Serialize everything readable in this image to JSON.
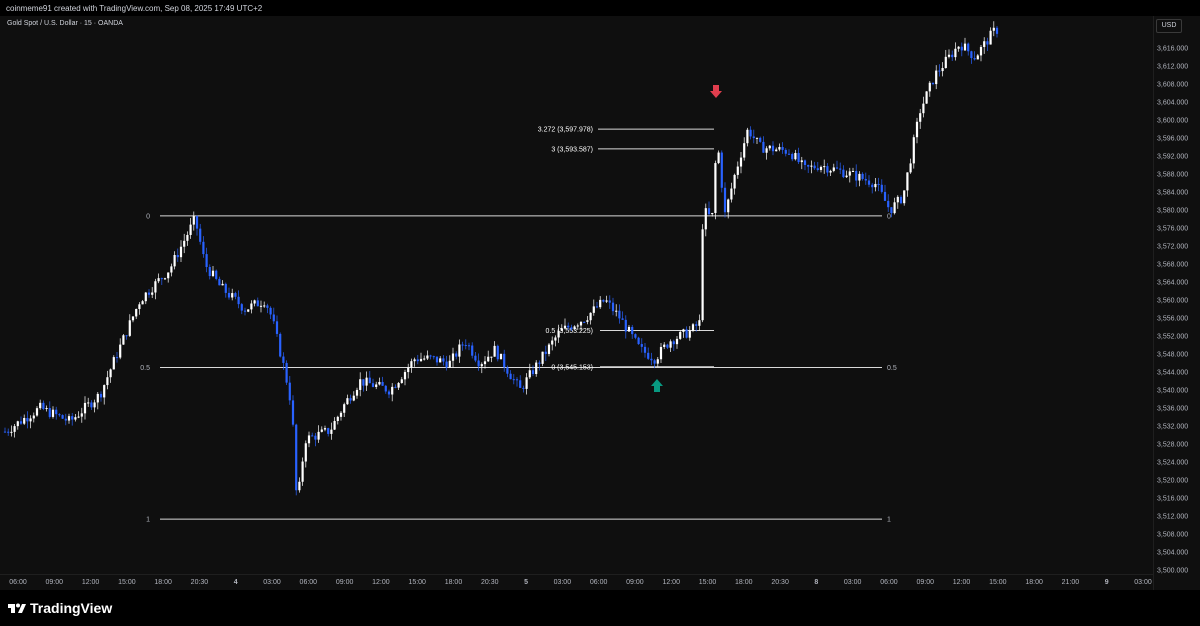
{
  "header": {
    "attribution": "coinmeme91 created with TradingView.com, Sep 08, 2025 17:49 UTC+2"
  },
  "chart": {
    "symbol_label": "Gold Spot / U.S. Dollar · 15 · OANDA",
    "currency": "USD",
    "colors": {
      "up": "#ffffff",
      "down": "#2962ff",
      "line": "#d9d9d9",
      "red_arrow": "#e03e4e",
      "green_arrow": "#089981"
    }
  },
  "chart_data": {
    "type": "candlestick",
    "ylim": [
      3500,
      3620
    ],
    "price_ticks": [
      "3,616.000",
      "3,612.000",
      "3,608.000",
      "3,604.000",
      "3,600.000",
      "3,596.000",
      "3,592.000",
      "3,588.000",
      "3,584.000",
      "3,580.000",
      "3,576.000",
      "3,572.000",
      "3,568.000",
      "3,564.000",
      "3,560.000",
      "3,556.000",
      "3,552.000",
      "3,548.000",
      "3,544.000",
      "3,540.000",
      "3,536.000",
      "3,532.000",
      "3,528.000",
      "3,524.000",
      "3,520.000",
      "3,516.000",
      "3,512.000",
      "3,508.000",
      "3,504.000",
      "3,500.000"
    ],
    "time_ticks": [
      "06:00",
      "09:00",
      "12:00",
      "15:00",
      "18:00",
      "20:30",
      "4",
      "03:00",
      "06:00",
      "09:00",
      "12:00",
      "15:00",
      "18:00",
      "20:30",
      "5",
      "03:00",
      "06:00",
      "09:00",
      "12:00",
      "15:00",
      "18:00",
      "20:30",
      "8",
      "03:00",
      "06:00",
      "09:00",
      "12:00",
      "15:00",
      "18:00",
      "21:00",
      "9",
      "03:00"
    ],
    "fib_main": [
      {
        "level": "0",
        "price": 3578.7
      },
      {
        "level": "0.5",
        "price": 3545.0
      },
      {
        "level": "1",
        "price": 3511.3
      }
    ],
    "fib_small": [
      {
        "label": "3.272 (3,597.978)",
        "price": 3597.978
      },
      {
        "label": "3 (3,593.587)",
        "price": 3593.587
      },
      {
        "label": "0.5 (3,553.225)",
        "price": 3553.225
      },
      {
        "label": "0 (3,545.153)",
        "price": 3545.153
      }
    ],
    "path": [
      [
        0,
        3530
      ],
      [
        40,
        3536
      ],
      [
        70,
        3533
      ],
      [
        100,
        3539
      ],
      [
        115,
        3547
      ],
      [
        140,
        3560
      ],
      [
        170,
        3567
      ],
      [
        195,
        3578
      ],
      [
        205,
        3568
      ],
      [
        220,
        3563
      ],
      [
        245,
        3558
      ],
      [
        265,
        3560
      ],
      [
        272,
        3556
      ],
      [
        285,
        3544
      ],
      [
        292,
        3536
      ],
      [
        297,
        3514
      ],
      [
        305,
        3529
      ],
      [
        330,
        3531
      ],
      [
        345,
        3537
      ],
      [
        360,
        3542
      ],
      [
        390,
        3540
      ],
      [
        415,
        3547
      ],
      [
        430,
        3547
      ],
      [
        450,
        3546
      ],
      [
        465,
        3551
      ],
      [
        480,
        3546
      ],
      [
        495,
        3549
      ],
      [
        520,
        3540
      ],
      [
        535,
        3545
      ],
      [
        560,
        3553
      ],
      [
        585,
        3556
      ],
      [
        605,
        3560
      ],
      [
        620,
        3556
      ],
      [
        640,
        3549
      ],
      [
        655,
        3547
      ],
      [
        670,
        3551
      ],
      [
        690,
        3553
      ],
      [
        700,
        3555
      ],
      [
        703,
        3580
      ],
      [
        712,
        3578
      ],
      [
        717,
        3596
      ],
      [
        725,
        3579
      ],
      [
        735,
        3588
      ],
      [
        748,
        3598
      ],
      [
        760,
        3594
      ],
      [
        790,
        3593
      ],
      [
        805,
        3589
      ],
      [
        820,
        3590
      ],
      [
        850,
        3588
      ],
      [
        875,
        3586
      ],
      [
        890,
        3580
      ],
      [
        903,
        3583
      ],
      [
        912,
        3593
      ],
      [
        920,
        3602
      ],
      [
        935,
        3610
      ],
      [
        960,
        3617
      ],
      [
        975,
        3614
      ],
      [
        995,
        3620
      ]
    ]
  },
  "footer": {
    "brand": "TradingView"
  }
}
